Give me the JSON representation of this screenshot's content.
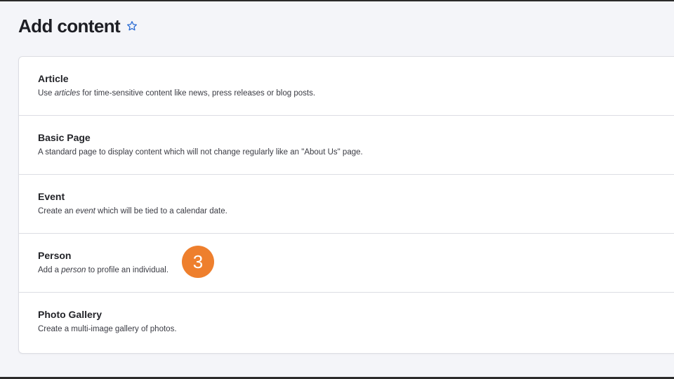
{
  "page": {
    "title": "Add content",
    "star_icon": "star-outline-icon",
    "accent_color": "#2f6fd4"
  },
  "content_types": [
    {
      "title": "Article",
      "desc_pre": "Use ",
      "desc_em": "articles",
      "desc_post": " for time-sensitive content like news, press releases or blog posts."
    },
    {
      "title": "Basic Page",
      "desc_pre": "A standard page to display content which will not change regularly like an \"About Us\" page.",
      "desc_em": "",
      "desc_post": ""
    },
    {
      "title": "Event",
      "desc_pre": "Create an ",
      "desc_em": "event",
      "desc_post": " which will be tied to a calendar date."
    },
    {
      "title": "Person",
      "desc_pre": "Add a ",
      "desc_em": "person",
      "desc_post": " to profile an individual."
    },
    {
      "title": "Photo Gallery",
      "desc_pre": "Create a multi-image gallery of photos.",
      "desc_em": "",
      "desc_post": ""
    }
  ],
  "step_badge": {
    "number": "3",
    "color": "#ee7f2d"
  }
}
